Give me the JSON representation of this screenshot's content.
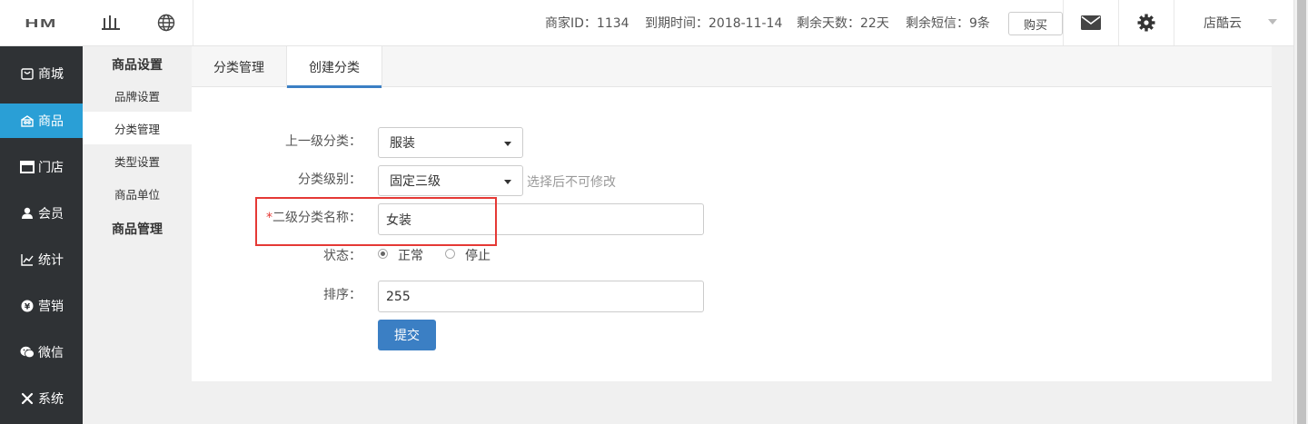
{
  "header": {
    "logo_text": "HM",
    "merchant_id": "商家ID：1134",
    "expire_time": "到期时间：2018-11-14",
    "remaining_days": "剩余天数：22天",
    "remaining_sms": "剩余短信：9条",
    "buy_label": "购买",
    "user_name": "店酷云"
  },
  "leftnav": {
    "items": [
      {
        "label": "商城",
        "icon": "store-icon"
      },
      {
        "label": "商品",
        "icon": "goods-icon"
      },
      {
        "label": "门店",
        "icon": "shop-icon"
      },
      {
        "label": "会员",
        "icon": "member-icon"
      },
      {
        "label": "统计",
        "icon": "chart-icon"
      },
      {
        "label": "营销",
        "icon": "marketing-icon"
      },
      {
        "label": "微信",
        "icon": "wechat-icon"
      },
      {
        "label": "系统",
        "icon": "tools-icon"
      }
    ],
    "active_index": 1
  },
  "subnav": {
    "section1": "商品设置",
    "items": [
      "品牌设置",
      "分类管理",
      "类型设置",
      "商品单位"
    ],
    "active_index": 1,
    "section2": "商品管理"
  },
  "tabs": [
    "分类管理",
    "创建分类"
  ],
  "form": {
    "parent_label": "上一级分类：",
    "parent_value": "服装",
    "level_label": "分类级别：",
    "level_value": "固定三级",
    "level_hint": "选择后不可修改",
    "name_required": "*",
    "name_label": "二级分类名称：",
    "name_value": "女装",
    "status_label": "状态：",
    "status_normal": "正常",
    "status_stop": "停止",
    "status_selected": "正常",
    "sort_label": "排序：",
    "sort_value": "255",
    "submit_label": "提交"
  },
  "colors": {
    "nav_bg": "#2f3235",
    "nav_active": "#2a9fd6",
    "primary": "#3b7fc4",
    "highlight": "#e53935"
  }
}
